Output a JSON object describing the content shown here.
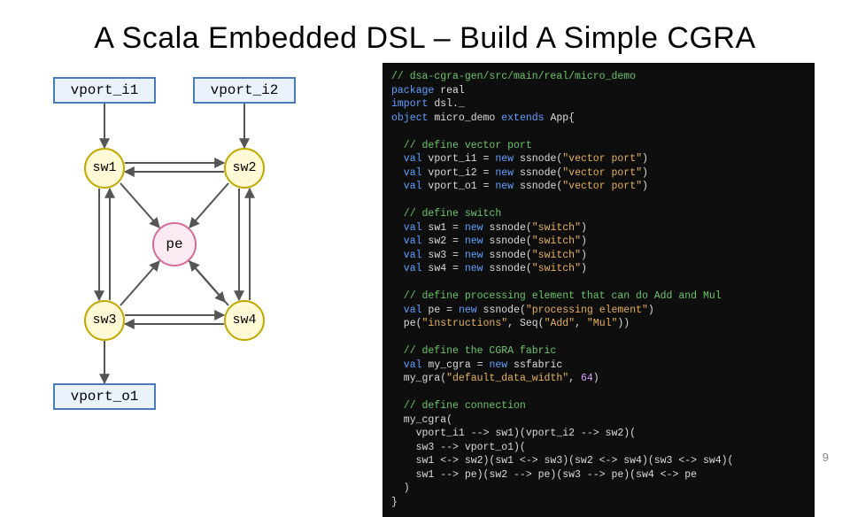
{
  "title": "A Scala Embedded DSL – Build A Simple CGRA",
  "page_number": "9",
  "diagram": {
    "vport_i1": "vport_i1",
    "vport_i2": "vport_i2",
    "vport_o1": "vport_o1",
    "sw1": "sw1",
    "sw2": "sw2",
    "sw3": "sw3",
    "sw4": "sw4",
    "pe": "pe"
  },
  "code": {
    "c1": "// dsa-cgra-gen/src/main/real/micro_demo",
    "l2a": "package",
    "l2b": " real",
    "l3a": "import",
    "l3b": " dsl._",
    "l4a": "object",
    "l4b": " micro_demo ",
    "l4c": "extends",
    "l4d": " App{",
    "c5": "  // define vector port",
    "l6a": "  val",
    "l6b": " vport_i1 = ",
    "l6c": "new",
    "l6d": " ssnode(",
    "l6e": "\"vector port\"",
    "l6f": ")",
    "l7a": "  val",
    "l7b": " vport_i2 = ",
    "l7c": "new",
    "l7d": " ssnode(",
    "l7e": "\"vector port\"",
    "l7f": ")",
    "l8a": "  val",
    "l8b": " vport_o1 = ",
    "l8c": "new",
    "l8d": " ssnode(",
    "l8e": "\"vector port\"",
    "l8f": ")",
    "c9": "  // define switch",
    "l10a": "  val",
    "l10b": " sw1 = ",
    "l10c": "new",
    "l10d": " ssnode(",
    "l10e": "\"switch\"",
    "l10f": ")",
    "l11a": "  val",
    "l11b": " sw2 = ",
    "l11c": "new",
    "l11d": " ssnode(",
    "l11e": "\"switch\"",
    "l11f": ")",
    "l12a": "  val",
    "l12b": " sw3 = ",
    "l12c": "new",
    "l12d": " ssnode(",
    "l12e": "\"switch\"",
    "l12f": ")",
    "l13a": "  val",
    "l13b": " sw4 = ",
    "l13c": "new",
    "l13d": " ssnode(",
    "l13e": "\"switch\"",
    "l13f": ")",
    "c14": "  // define processing element that can do Add and Mul",
    "l15a": "  val",
    "l15b": " pe = ",
    "l15c": "new",
    "l15d": " ssnode(",
    "l15e": "\"processing element\"",
    "l15f": ")",
    "l16a": "  pe(",
    "l16b": "\"instructions\"",
    "l16c": ", Seq(",
    "l16d": "\"Add\"",
    "l16e": ", ",
    "l16f": "\"Mul\"",
    "l16g": "))",
    "c17": "  // define the CGRA fabric",
    "l18a": "  val",
    "l18b": " my_cgra = ",
    "l18c": "new",
    "l18d": " ssfabric",
    "l19a": "  my_gra(",
    "l19b": "\"default_data_width\"",
    "l19c": ", ",
    "l19d": "64",
    "l19e": ")",
    "c20": "  // define connection",
    "l21": "  my_cgra(",
    "l22": "    vport_i1 --> sw1)(vport_i2 --> sw2)(",
    "l23": "    sw3 --> vport_o1)(",
    "l24": "    sw1 <-> sw2)(sw1 <-> sw3)(sw2 <-> sw4)(sw3 <-> sw4)(",
    "l25": "    sw1 --> pe)(sw2 --> pe)(sw3 --> pe)(sw4 <-> pe",
    "l26": "  )",
    "l27": "}"
  }
}
